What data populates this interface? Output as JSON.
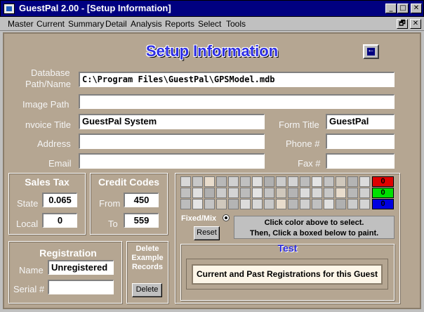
{
  "window": {
    "title": "GuestPal 2.00 - [Setup Information]",
    "controls": {
      "minimize": "_",
      "maximize": "□",
      "close": "✕"
    }
  },
  "menu": [
    "Master",
    "Current",
    "Summary",
    "Detail",
    "Analysis",
    "Reports",
    "Select",
    "Tools"
  ],
  "mdi_controls": {
    "restore": "🗗",
    "close": "✕"
  },
  "form": {
    "heading": "Setup Information",
    "fields": {
      "db_path_label_1": "Database",
      "db_path_label_2": "Path/Name",
      "db_path_value": "C:\\Program Files\\GuestPal\\GPSModel.mdb",
      "image_path_label": "Image Path",
      "image_path_value": "",
      "invoice_title_label": "nvoice Title",
      "invoice_title_value": "GuestPal System",
      "form_title_label": "Form Title",
      "form_title_value": "GuestPal",
      "address_label": "Address",
      "address_value": "",
      "phone_label": "Phone #",
      "phone_value": "",
      "email_label": "Email",
      "email_value": "",
      "fax_label": "Fax #",
      "fax_value": ""
    },
    "sales_tax": {
      "title": "Sales Tax",
      "state_label": "State",
      "state_value": "0.065",
      "local_label": "Local",
      "local_value": "0"
    },
    "credit_codes": {
      "title": "Credit Codes",
      "from_label": "From",
      "from_value": "450",
      "to_label": "To",
      "to_value": "559"
    },
    "registration": {
      "title": "Registration",
      "name_label": "Name",
      "name_value": "Unregistered",
      "serial_label": "Serial #",
      "serial_value": ""
    },
    "delete_examples": {
      "line1": "Delete",
      "line2": "Example",
      "line3": "Records",
      "button": "Delete"
    },
    "color_panel": {
      "rgb_values": {
        "red": "0",
        "green": "0",
        "blue": "0"
      },
      "fixed_mix_label": "Fixed/Mix",
      "reset_button": "Reset",
      "instruction_1": "Click color above to select.",
      "instruction_2": "Then, Click a boxed below to paint.",
      "test_title": "Test",
      "test_text": "Current and Past Registrations for this Guest"
    }
  },
  "colors": {
    "form_bg": "#b5a692",
    "title_bar": "#000080",
    "heading": "#2e2ee6",
    "red": "#e00000",
    "green": "#00e000",
    "blue": "#0000e0"
  }
}
